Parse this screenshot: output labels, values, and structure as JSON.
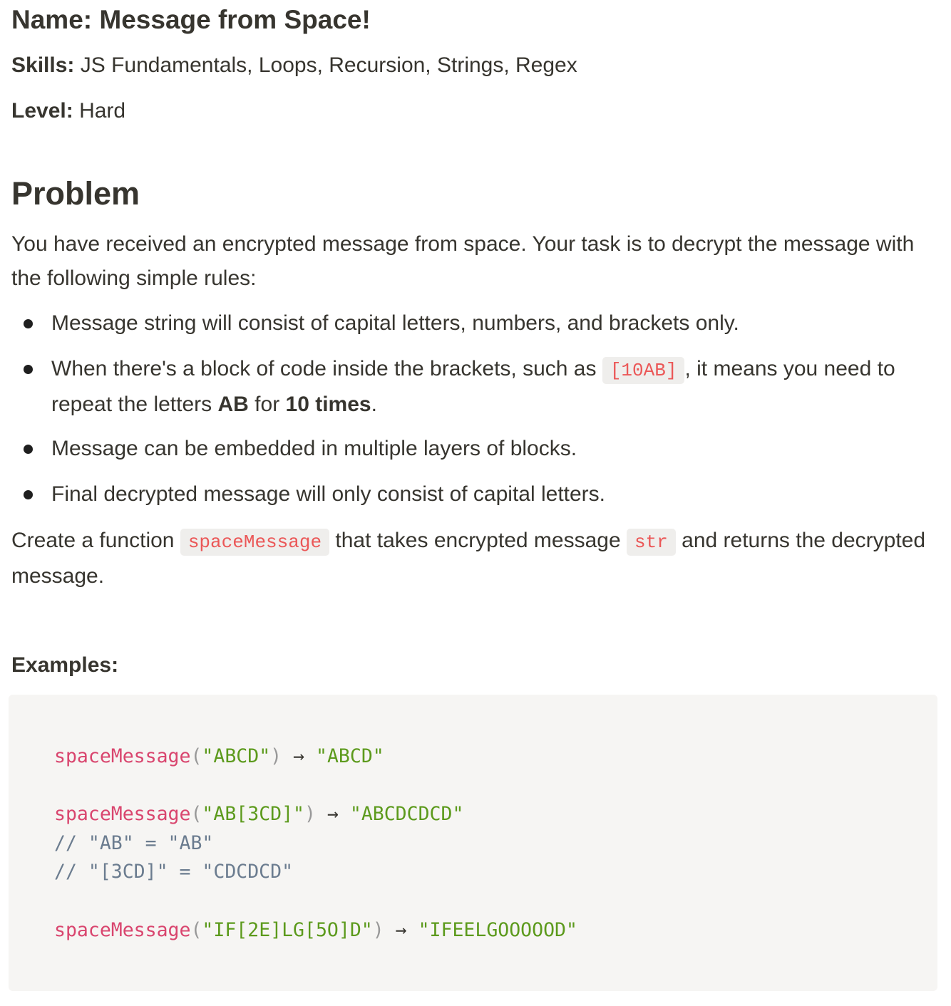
{
  "header": {
    "name_label": "Name:",
    "name_value": "Message from Space!",
    "skills_label": "Skills:",
    "skills_value": "JS Fundamentals, Loops, Recursion, Strings, Regex",
    "level_label": "Level:",
    "level_value": "Hard"
  },
  "problem": {
    "heading": "Problem",
    "intro": "You have received an encrypted message from space. Your task is to decrypt the message with the following simple rules:",
    "rules": {
      "rule1": "Message string will consist of capital letters, numbers, and brackets only.",
      "rule2_a": "When there's a block of code inside the brackets, such as",
      "rule2_code": "[10AB]",
      "rule2_b": ", it means you need to repeat the letters",
      "rule2_letters": "AB",
      "rule2_c": "for",
      "rule2_times": "10 times",
      "rule2_d": ".",
      "rule3": "Message can be embedded in multiple layers of blocks.",
      "rule4": "Final decrypted message will only consist of capital letters."
    },
    "task_a": "Create a function",
    "task_fn": "spaceMessage",
    "task_b": "that takes encrypted message",
    "task_arg": "str",
    "task_c": "and returns the decrypted message."
  },
  "examples": {
    "label": "Examples:",
    "ex1": {
      "fn": "spaceMessage",
      "open": "(",
      "arg": "\"ABCD\"",
      "close": ")",
      "arrow": " → ",
      "result": "\"ABCD\""
    },
    "ex2": {
      "fn": "spaceMessage",
      "open": "(",
      "arg": "\"AB[3CD]\"",
      "close": ")",
      "arrow": " → ",
      "result": "\"ABCDCDCD\""
    },
    "comment1": "// \"AB\" = \"AB\"",
    "comment2": "// \"[3CD]\" = \"CDCDCD\"",
    "ex3": {
      "fn": "spaceMessage",
      "open": "(",
      "arg": "\"IF[2E]LG[5O]D\"",
      "close": ")",
      "arrow": " → ",
      "result": "\"IFEELGOOOOOD\""
    }
  }
}
